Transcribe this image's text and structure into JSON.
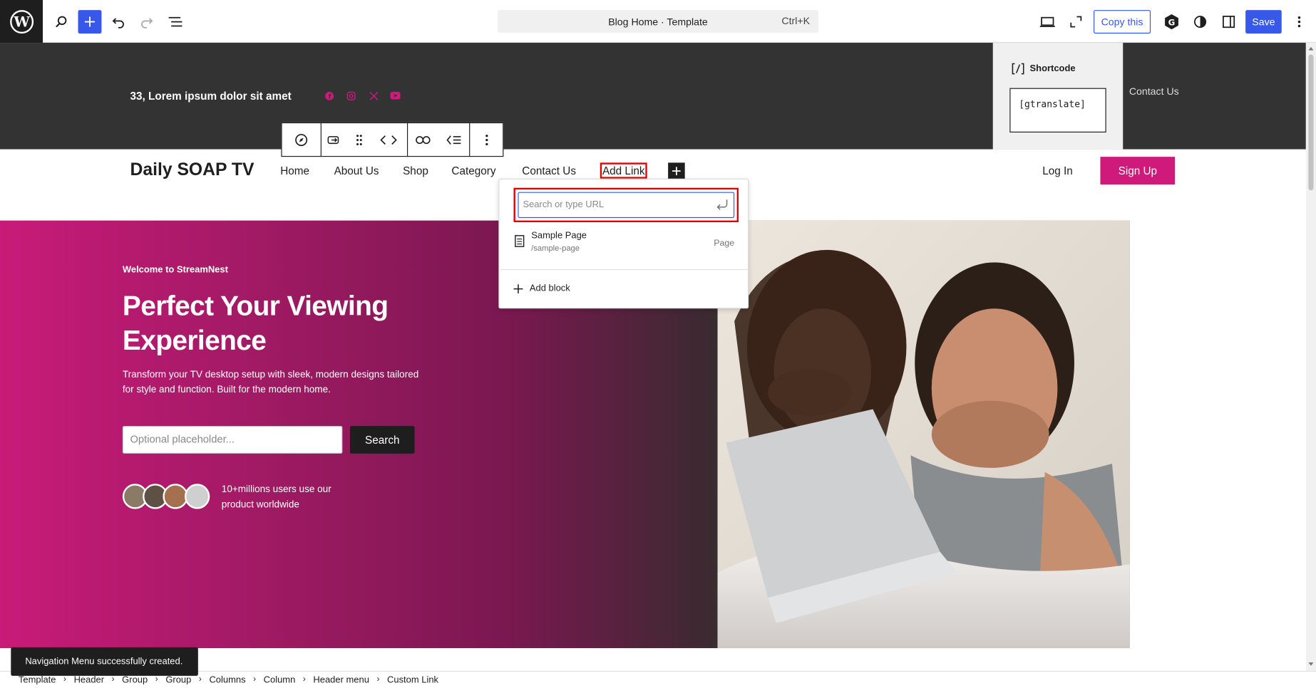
{
  "topbar": {
    "document_title": "Blog Home · Template",
    "shortcut": "Ctrl+K",
    "copy_label": "Copy this",
    "save_label": "Save"
  },
  "header_top": {
    "address": "33, Lorem ipsum dolor sit amet",
    "shortcode_title": "Shortcode",
    "shortcode_value": "[gtranslate]",
    "contact_label": "Contact Us",
    "social_icons": [
      "facebook-icon",
      "instagram-icon",
      "x-icon",
      "youtube-icon"
    ],
    "social_color": "#cf1a7c"
  },
  "header": {
    "site_title": "Daily SOAP TV",
    "nav": [
      "Home",
      "About Us",
      "Shop",
      "Category",
      "Contact Us"
    ],
    "add_link": "Add Link",
    "login": "Log In",
    "signup": "Sign Up",
    "accent": "#cf1a7c"
  },
  "hero": {
    "kicker": "Welcome to StreamNest",
    "title": "Perfect Your Viewing Experience",
    "desc_line1": "Transform your TV desktop setup with sleek, modern designs tailored",
    "desc_line2": "for style and function. Built for the modern home.",
    "input_placeholder": "Optional placeholder...",
    "search_label": "Search",
    "users_text": "10+millions users use our product worldwide"
  },
  "link_popover": {
    "search_placeholder": "Search or type URL",
    "result_title": "Sample Page",
    "result_url": "/sample-page",
    "result_type": "Page",
    "add_block": "Add block"
  },
  "toast": "Navigation Menu successfully created.",
  "breadcrumb": [
    "Template",
    "Header",
    "Group",
    "Group",
    "Columns",
    "Column",
    "Header menu",
    "Custom Link"
  ]
}
